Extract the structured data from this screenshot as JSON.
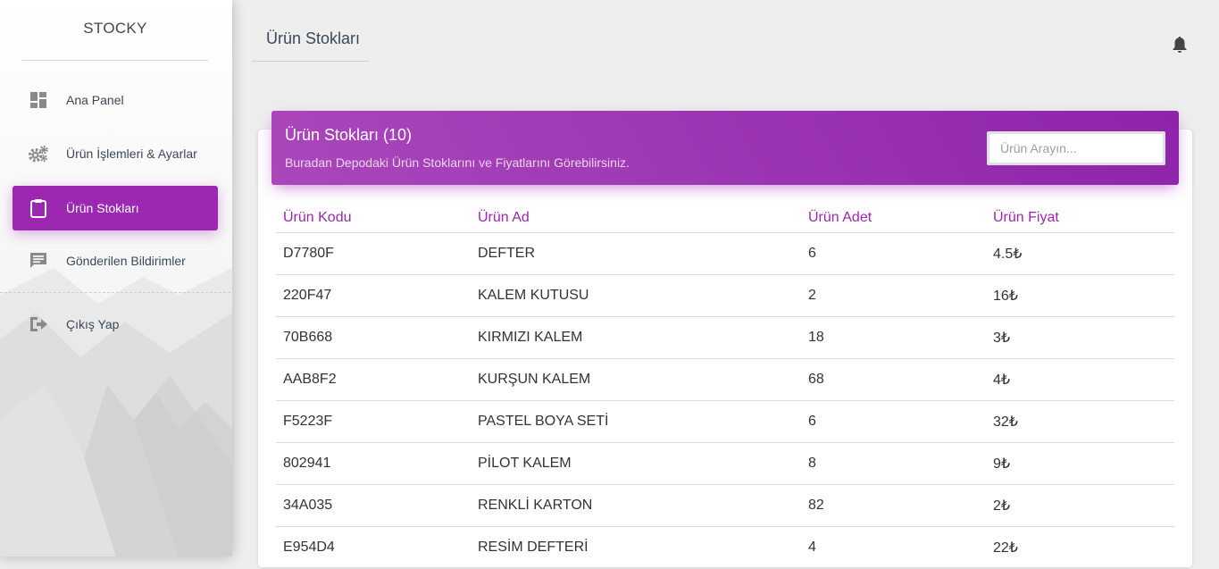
{
  "app": {
    "name": "STOCKY"
  },
  "sidebar": {
    "items": [
      {
        "label": "Ana Panel",
        "icon": "dashboard-icon",
        "active": false
      },
      {
        "label": "Ürün İşlemleri & Ayarlar",
        "icon": "gears-icon",
        "active": false
      },
      {
        "label": "Ürün Stokları",
        "icon": "clipboard-icon",
        "active": true
      },
      {
        "label": "Gönderilen Bildirimler",
        "icon": "message-icon",
        "active": false
      }
    ],
    "logout": {
      "label": "Çıkış Yap",
      "icon": "exit-icon"
    }
  },
  "topbar": {
    "title": "Ürün Stokları",
    "notification_icon": "bell-icon"
  },
  "card": {
    "title": "Ürün Stokları (10)",
    "subtitle": "Buradan Depodaki Ürün Stoklarını ve Fiyatlarını Görebilirsiniz.",
    "search_placeholder": "Ürün Arayın..."
  },
  "table": {
    "headers": [
      "Ürün Kodu",
      "Ürün Ad",
      "Ürün Adet",
      "Ürün Fiyat"
    ],
    "rows": [
      [
        "D7780F",
        "DEFTER",
        "6",
        "4.5₺"
      ],
      [
        "220F47",
        "KALEM KUTUSU",
        "2",
        "16₺"
      ],
      [
        "70B668",
        "KIRMIZI KALEM",
        "18",
        "3₺"
      ],
      [
        "AAB8F2",
        "KURŞUN KALEM",
        "68",
        "4₺"
      ],
      [
        "F5223F",
        "PASTEL BOYA SETİ",
        "6",
        "32₺"
      ],
      [
        "802941",
        "PİLOT KALEM",
        "8",
        "9₺"
      ],
      [
        "34A035",
        "RENKLİ KARTON",
        "82",
        "2₺"
      ],
      [
        "E954D4",
        "RESİM DEFTERİ",
        "4",
        "22₺"
      ]
    ]
  },
  "colors": {
    "accent": "#9c27b0",
    "header_gradient_start": "#ab47bc",
    "header_gradient_end": "#8e24aa"
  }
}
